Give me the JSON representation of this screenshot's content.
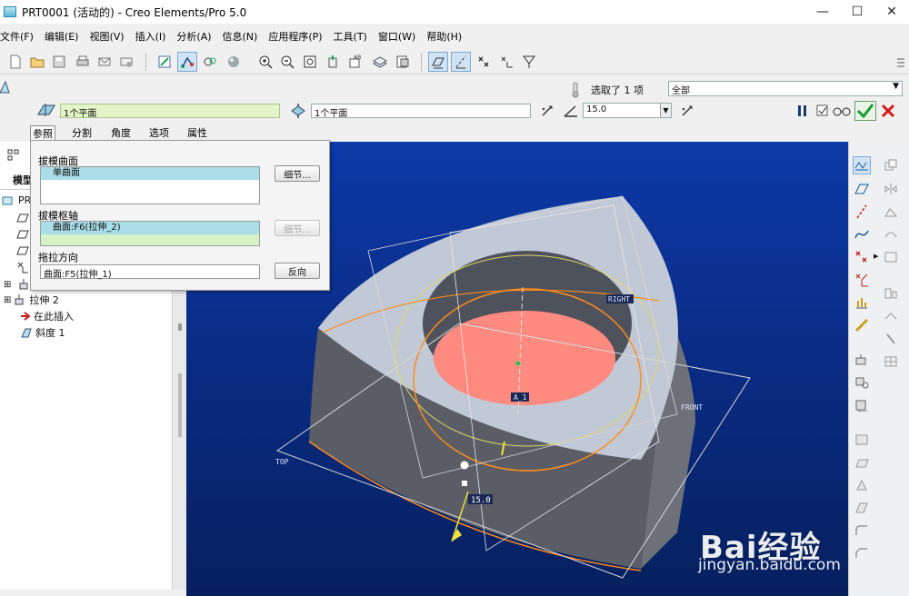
{
  "window": {
    "title": "PRT0001 (活动的) - Creo Elements/Pro 5.0",
    "minimize": "—",
    "maximize": "☐",
    "close": "✕"
  },
  "menu": [
    "文件(F)",
    "编辑(E)",
    "视图(V)",
    "插入(I)",
    "分析(A)",
    "信息(N)",
    "应用程序(P)",
    "工具(T)",
    "窗口(W)",
    "帮助(H)"
  ],
  "dashboard": {
    "selected_status": "选取了 1 项",
    "filter_value": "全部",
    "ref1": "1个平面",
    "ref2": "1个平面",
    "angle": "15.0",
    "tabs": [
      "参照",
      "分割",
      "角度",
      "选项",
      "属性"
    ]
  },
  "panel": {
    "draft_surfaces_label": "拔模曲面",
    "draft_surfaces_value": "单曲面",
    "details_btn": "细节...",
    "hinge_label": "拔模枢轴",
    "hinge_value": "曲面:F6(拉伸_2)",
    "hinge_details_btn": "细节...",
    "direction_label": "拖拉方向",
    "direction_value": "曲面:F5(拉伸_1)",
    "flip_btn": "反向"
  },
  "tree": {
    "header": "模型",
    "root": "PR",
    "items": [
      "拉伸 2",
      "在此插入",
      "斜度 1"
    ]
  },
  "viewport": {
    "labels": {
      "right": "RIGHT",
      "front": "FRONT",
      "top": "TOP",
      "axis": "A_1",
      "angle": "15.0"
    }
  },
  "watermark": {
    "brand": "Bai经验",
    "url": "jingyan.baidu.com"
  },
  "colors": {
    "viewport_top": "#0d3aa8",
    "viewport_bottom": "#06205e",
    "highlight": "#ff8a80",
    "edge": "#ff8c1a",
    "ok": "#1a9a2a",
    "cancel": "#d61a1a"
  }
}
